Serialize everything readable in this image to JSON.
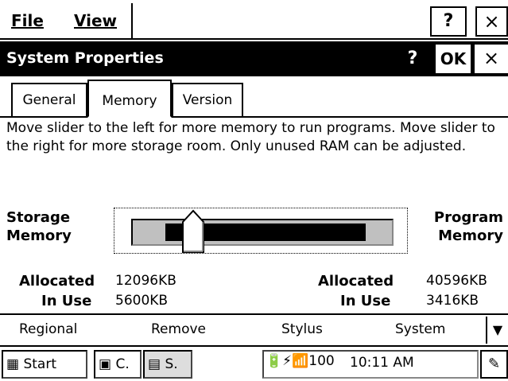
{
  "menu": {
    "file": "File",
    "view": "View",
    "help": "?",
    "close": "×"
  },
  "dialog": {
    "title": "System Properties",
    "help": "?",
    "ok": "OK",
    "close": "×"
  },
  "tabs": [
    {
      "label": "General"
    },
    {
      "label": "Memory"
    },
    {
      "label": "Version"
    }
  ],
  "description": "Move slider to the left for more memory to run programs. Move slider to the right for more storage room. Only unused RAM can be adjusted.",
  "storage": {
    "label_line1": "Storage",
    "label_line2": "Memory",
    "allocated_label": "Allocated",
    "allocated_value": "12096KB",
    "in_use_label": "In Use",
    "in_use_value": "5600KB"
  },
  "program": {
    "label_line1": "Program",
    "label_line2": "Memory",
    "allocated_label": "Allocated",
    "allocated_value": "40596KB",
    "in_use_label": "In Use",
    "in_use_value": "3416KB"
  },
  "slider": {
    "position_fraction": 0.23
  },
  "control_panel": {
    "items": [
      {
        "label": "Regional"
      },
      {
        "label": "Remove"
      },
      {
        "label": "Stylus"
      },
      {
        "label": "System"
      }
    ],
    "arrow": "▼"
  },
  "taskbar": {
    "start": "Start",
    "app1": "C.",
    "app2": "S.",
    "time": "10:11 AM",
    "tray_icons": "🔋⚡📶100"
  }
}
